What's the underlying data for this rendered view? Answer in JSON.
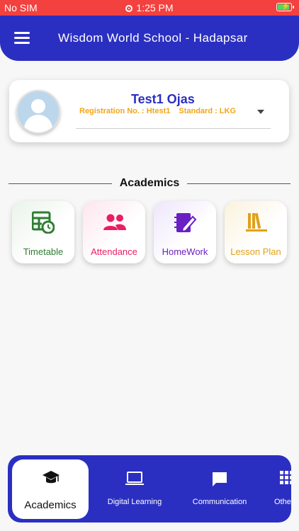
{
  "status_bar": {
    "carrier": "No SIM",
    "time": "1:25 PM"
  },
  "app_bar": {
    "title": "Wisdom World School - Hadapsar"
  },
  "profile": {
    "name": "Test1 Ojas",
    "registration": "Registration No. : Htest1",
    "standard": "Standard : LKG"
  },
  "section": {
    "title": "Academics"
  },
  "tiles": [
    {
      "label": "Timetable",
      "icon": "timetable-icon",
      "color": "#2e7d32"
    },
    {
      "label": "Attendance",
      "icon": "people-icon",
      "color": "#e91e63"
    },
    {
      "label": "HomeWork",
      "icon": "homework-icon",
      "color": "#6a1fc2"
    },
    {
      "label": "Lesson Plan",
      "icon": "books-icon",
      "color": "#e0a11a"
    }
  ],
  "bottom_nav": {
    "items": [
      {
        "label": "Academics",
        "icon": "graduation-cap-icon",
        "active": true
      },
      {
        "label": "Digital Learning",
        "icon": "laptop-icon"
      },
      {
        "label": "Communication",
        "icon": "chat-icon"
      },
      {
        "label": "Othe",
        "icon": "grid-icon"
      }
    ]
  },
  "colors": {
    "primary": "#2b2fc1",
    "status_bar": "#f2413f",
    "accent": "#f2a51a"
  }
}
